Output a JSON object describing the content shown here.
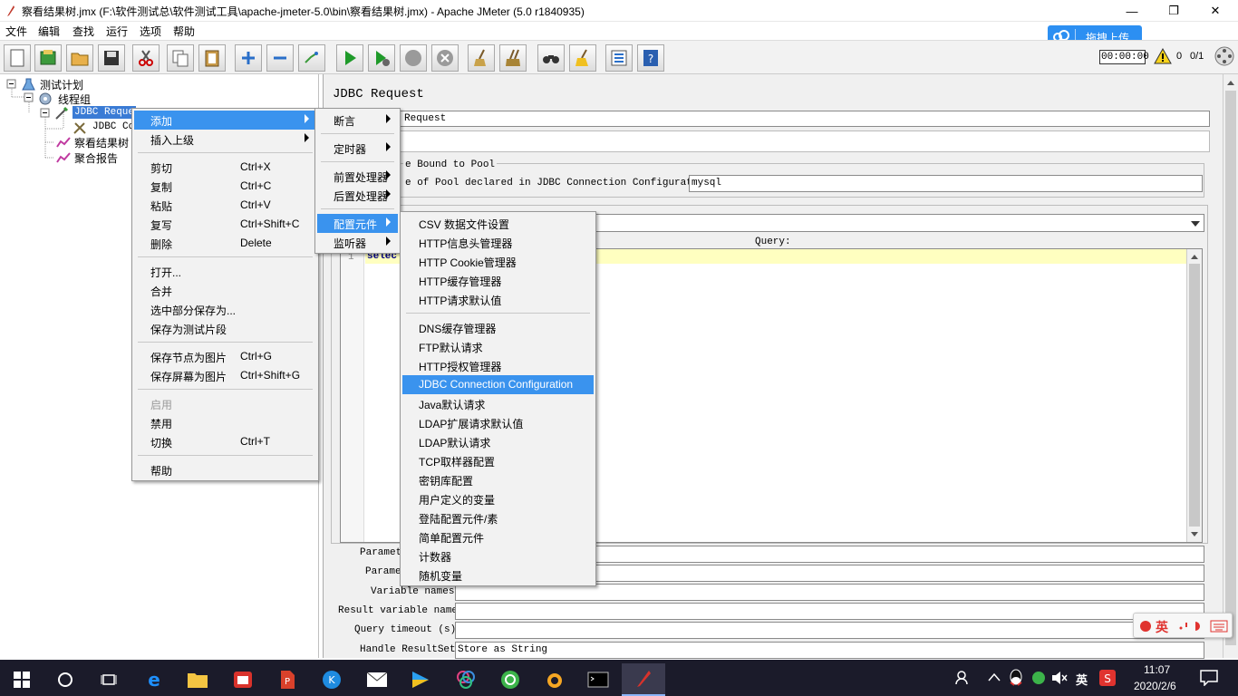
{
  "window": {
    "title": "察看结果树.jmx (F:\\软件测试总\\软件测试工具\\apache-jmeter-5.0\\bin\\察看结果树.jmx) - Apache JMeter (5.0 r1840935)",
    "controls": [
      "—",
      "❐",
      "✕"
    ]
  },
  "menubar": [
    "文件",
    "编辑",
    "查找",
    "运行",
    "选项",
    "帮助"
  ],
  "cloud_upload": "拖拽上传",
  "status": {
    "timer": "00:00:00",
    "warnings": "0",
    "threads": "0/1"
  },
  "tree": {
    "test_plan": "测试计划",
    "thread_group": "线程组",
    "jdbc_request": "JDBC Reque",
    "jdbc_config": "JDBC Co",
    "view_results_tree": "察看结果树",
    "aggregate_report": "聚合报告"
  },
  "panel": {
    "title": "JDBC Request",
    "name_value": "Request",
    "bound_to_pool": "e Bound to Pool",
    "pool_label": "e of Pool declared in JDBC Connection Configuration:",
    "pool_value": "mysql",
    "query_label": "Query:",
    "line_number": "1",
    "query_text": "selec",
    "param_label1": "Paramet",
    "param_label2": "Parame",
    "variable_names": "Variable names:",
    "result_variable": "Result variable name:",
    "query_timeout": "Query timeout (s):",
    "handle_resultset": "Handle ResultSet:",
    "handle_value": "Store as String"
  },
  "context_menu": {
    "items": [
      {
        "label": "添加",
        "shortcut": "",
        "submenu": true,
        "highlight": true,
        "disabled": false
      },
      {
        "label": "插入上级",
        "shortcut": "",
        "submenu": true,
        "highlight": false,
        "disabled": false
      },
      {
        "sep": true
      },
      {
        "label": "剪切",
        "shortcut": "Ctrl+X",
        "disabled": false
      },
      {
        "label": "复制",
        "shortcut": "Ctrl+C",
        "disabled": false
      },
      {
        "label": "粘贴",
        "shortcut": "Ctrl+V",
        "disabled": false
      },
      {
        "label": "复写",
        "shortcut": "Ctrl+Shift+C",
        "disabled": false
      },
      {
        "label": "删除",
        "shortcut": "Delete",
        "disabled": false
      },
      {
        "sep": true
      },
      {
        "label": "打开...",
        "shortcut": "",
        "disabled": false
      },
      {
        "label": "合并",
        "shortcut": "",
        "disabled": false
      },
      {
        "label": "选中部分保存为...",
        "shortcut": "",
        "disabled": false
      },
      {
        "label": "保存为测试片段",
        "shortcut": "",
        "disabled": false
      },
      {
        "sep": true
      },
      {
        "label": "保存节点为图片",
        "shortcut": "Ctrl+G",
        "disabled": false
      },
      {
        "label": "保存屏幕为图片",
        "shortcut": "Ctrl+Shift+G",
        "disabled": false
      },
      {
        "sep": true
      },
      {
        "label": "启用",
        "shortcut": "",
        "disabled": true
      },
      {
        "label": "禁用",
        "shortcut": "",
        "disabled": false
      },
      {
        "label": "切换",
        "shortcut": "Ctrl+T",
        "disabled": false
      },
      {
        "sep": true
      },
      {
        "label": "帮助",
        "shortcut": "",
        "disabled": false
      }
    ]
  },
  "add_submenu": {
    "items": [
      {
        "label": "断言",
        "highlight": false
      },
      {
        "sep": true
      },
      {
        "label": "定时器",
        "highlight": false
      },
      {
        "sep": true
      },
      {
        "label": "前置处理器",
        "highlight": false
      },
      {
        "label": "后置处理器",
        "highlight": false
      },
      {
        "sep": true
      },
      {
        "label": "配置元件",
        "highlight": true
      },
      {
        "label": "监听器",
        "highlight": false
      }
    ]
  },
  "config_submenu": {
    "items": [
      {
        "label": "CSV 数据文件设置"
      },
      {
        "label": "HTTP信息头管理器"
      },
      {
        "label": "HTTP Cookie管理器"
      },
      {
        "label": "HTTP缓存管理器"
      },
      {
        "label": "HTTP请求默认值"
      },
      {
        "sep": true
      },
      {
        "label": "DNS缓存管理器"
      },
      {
        "label": "FTP默认请求"
      },
      {
        "label": "HTTP授权管理器"
      },
      {
        "label": "JDBC Connection Configuration",
        "highlight": true
      },
      {
        "label": "Java默认请求"
      },
      {
        "label": "LDAP扩展请求默认值"
      },
      {
        "label": "LDAP默认请求"
      },
      {
        "label": "TCP取样器配置"
      },
      {
        "label": "密钥库配置"
      },
      {
        "label": "用户定义的变量"
      },
      {
        "label": "登陆配置元件/素"
      },
      {
        "label": "简单配置元件"
      },
      {
        "label": "计数器"
      },
      {
        "label": "随机变量"
      }
    ]
  },
  "ime": {
    "lang": "英"
  },
  "tray": {
    "ime": "英",
    "time": "11:07",
    "date": "2020/2/6"
  },
  "colors": {
    "highlight": "#3a93ee",
    "taskbar": "#1b1b2a",
    "query_line": "#ffffc0"
  }
}
